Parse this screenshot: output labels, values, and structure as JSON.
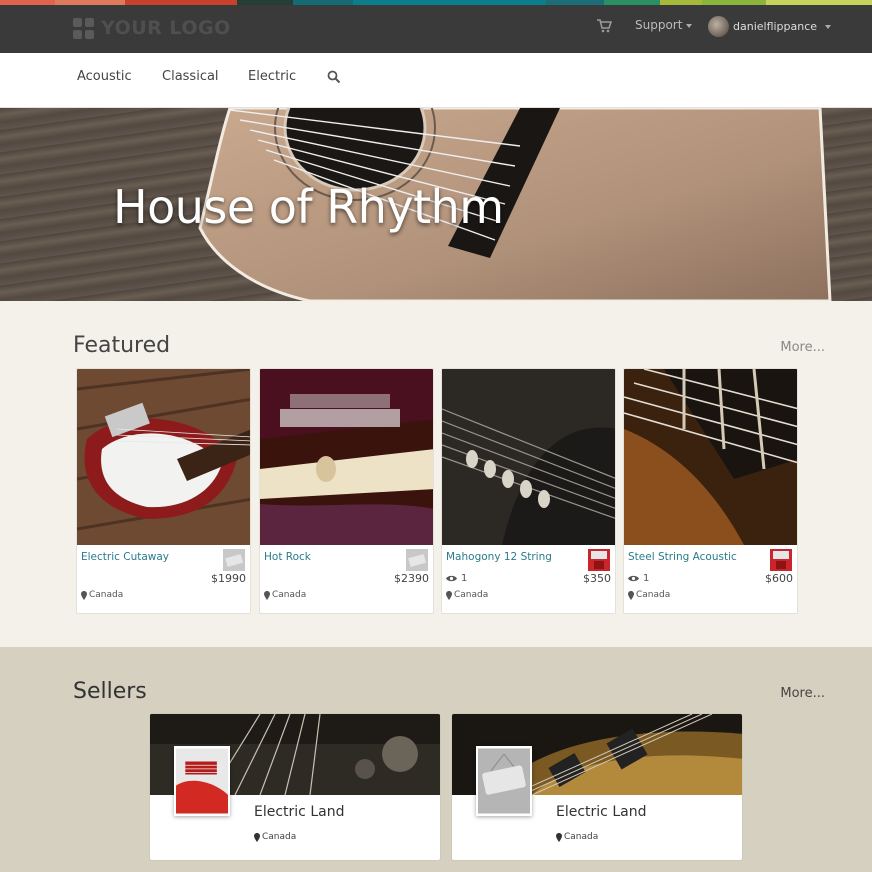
{
  "colors": {
    "strip": [
      "#e0644d",
      "#c9412c",
      "#263f35",
      "#156b73",
      "#0a7f8b",
      "#2a8f62",
      "#a6b93b",
      "#c7d25a"
    ],
    "topbar": "#3a3a3a",
    "link": "#2a7b8c",
    "featured_bg": "#f3f1ea",
    "sellers_bg": "#d6d0c0"
  },
  "header": {
    "logo_text": "YOUR LOGO",
    "support_label": "Support",
    "username": "danielflippance"
  },
  "nav": {
    "items": [
      "Acoustic",
      "Classical",
      "Electric"
    ]
  },
  "hero": {
    "title": "House of Rhythm"
  },
  "featured": {
    "title": "Featured",
    "more_label": "More...",
    "cards": [
      {
        "name": "Electric Cutaway",
        "price": "$1990",
        "views": "",
        "location": "Canada",
        "badge": "sale-tag-icon"
      },
      {
        "name": "Hot Rock",
        "price": "$2390",
        "views": "",
        "location": "Canada",
        "badge": "sale-tag-icon"
      },
      {
        "name": "Mahogony 12 String",
        "price": "$350",
        "views": "1",
        "location": "Canada",
        "badge": "guitar-thumb-icon"
      },
      {
        "name": "Steel String Acoustic",
        "price": "$600",
        "views": "1",
        "location": "Canada",
        "badge": "guitar-thumb-icon"
      }
    ]
  },
  "sellers": {
    "title": "Sellers",
    "more_label": "More...",
    "items": [
      {
        "name": "Electric Land",
        "location": "Canada",
        "thumb": "red-guitar-thumbnail"
      },
      {
        "name": "Electric Land",
        "location": "Canada",
        "thumb": "open-sign-thumbnail"
      }
    ]
  }
}
